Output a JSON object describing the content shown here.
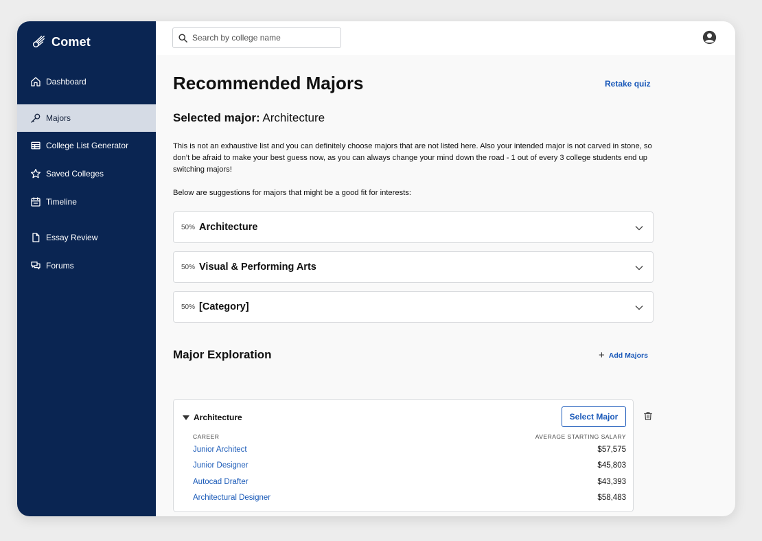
{
  "app": {
    "name": "Comet"
  },
  "sidebar": {
    "items": [
      {
        "label": "Dashboard",
        "icon": "home-icon"
      },
      {
        "label": "Majors",
        "icon": "key-icon",
        "active": true
      },
      {
        "label": "College List Generator",
        "icon": "table-icon"
      },
      {
        "label": "Saved Colleges",
        "icon": "star-icon"
      },
      {
        "label": "Timeline",
        "icon": "calendar-icon"
      },
      {
        "label": "Essay Review",
        "icon": "document-icon"
      },
      {
        "label": "Forums",
        "icon": "chat-icon"
      }
    ]
  },
  "header": {
    "search_placeholder": "Search by college name",
    "avatar_icon": "user-circle-icon"
  },
  "main": {
    "title": "Recommended Majors",
    "retake_label": "Retake quiz",
    "selected_label": "Selected major:",
    "selected_value": "Architecture",
    "intro": "This is not an exhaustive list and you can definitely choose majors that are not listed here. Also your intended major is not carved in stone, so don’t be afraid to make your best guess now, as you can always change your mind down the road - 1 out of every 3 college students end up switching majors!",
    "intro2": "Below are suggestions for majors that might be a good fit for interests:",
    "recommendations": [
      {
        "percent": "50%",
        "name": "Architecture"
      },
      {
        "percent": "50%",
        "name": "Visual & Performing Arts"
      },
      {
        "percent": "50%",
        "name": "[Category]"
      }
    ],
    "exploration": {
      "title": "Major Exploration",
      "add_label": "Add Majors",
      "card": {
        "major": "Architecture",
        "select_label": "Select Major",
        "col_career": "CAREER",
        "col_salary": "AVERAGE STARTING SALARY",
        "rows": [
          {
            "career": "Junior Architect",
            "salary": "$57,575"
          },
          {
            "career": "Junior Designer",
            "salary": "$45,803"
          },
          {
            "career": "Autocad Drafter",
            "salary": "$43,393"
          },
          {
            "career": "Architectural Designer",
            "salary": "$58,483"
          }
        ]
      }
    }
  },
  "colors": {
    "sidebar_bg": "#0a2552",
    "sidebar_active_bg": "#d5dbe5",
    "accent": "#1958b9"
  }
}
